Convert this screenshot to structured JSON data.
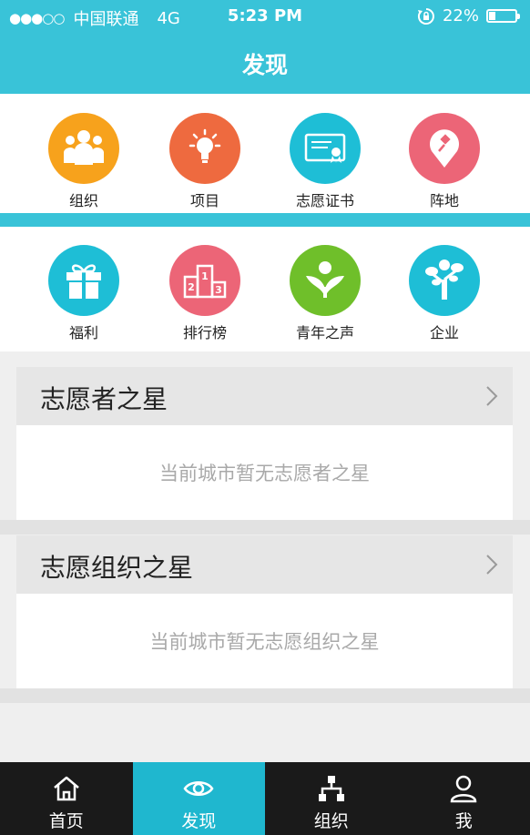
{
  "status_bar": {
    "carrier": "中国联通",
    "network": "4G",
    "time": "5:23 PM",
    "battery": "22%",
    "battery_level": 0.22,
    "signal_dots": "●●●○○"
  },
  "header": {
    "title": "发现"
  },
  "grid1": [
    {
      "label": "组织",
      "icon": "people-group-icon",
      "color": "#f7a21c"
    },
    {
      "label": "项目",
      "icon": "lightbulb-icon",
      "color": "#ee6a3f"
    },
    {
      "label": "志愿证书",
      "icon": "certificate-icon",
      "color": "#1ebed6"
    },
    {
      "label": "阵地",
      "icon": "pin-location-icon",
      "color": "#ec6577"
    }
  ],
  "grid2": [
    {
      "label": "福利",
      "icon": "gift-icon",
      "color": "#1ebed6"
    },
    {
      "label": "排行榜",
      "icon": "podium-ranking-icon",
      "color": "#ec6577"
    },
    {
      "label": "青年之声",
      "icon": "sprout-icon",
      "color": "#6fbf2a"
    },
    {
      "label": "企业",
      "icon": "tree-icon",
      "color": "#1ebed6"
    }
  ],
  "sections": [
    {
      "title": "志愿者之星",
      "empty_text": "当前城市暂无志愿者之星"
    },
    {
      "title": "志愿组织之星",
      "empty_text": "当前城市暂无志愿组织之星"
    }
  ],
  "tabbar": [
    {
      "label": "首页",
      "icon": "home-icon",
      "active": false
    },
    {
      "label": "发现",
      "icon": "eye-icon",
      "active": true
    },
    {
      "label": "组织",
      "icon": "org-chart-icon",
      "active": false
    },
    {
      "label": "我",
      "icon": "user-icon",
      "active": false
    }
  ]
}
